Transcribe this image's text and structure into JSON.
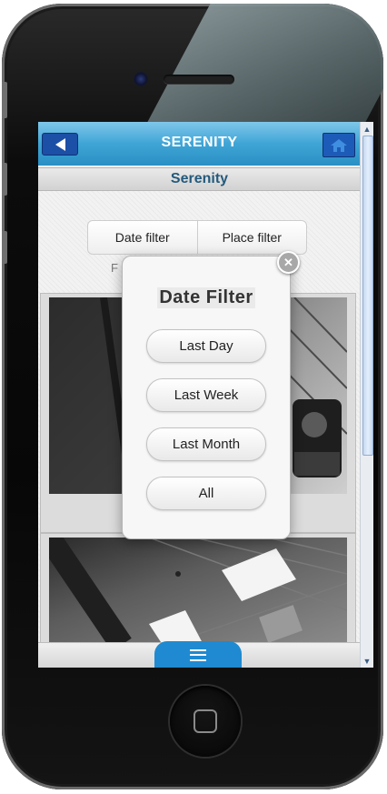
{
  "app": {
    "title": "SERENITY",
    "subtitle": "Serenity"
  },
  "filters": {
    "date_label": "Date filter",
    "place_label": "Place filter",
    "partial_label": "F"
  },
  "popup": {
    "title": "Date Filter",
    "options": [
      "Last Day",
      "Last Week",
      "Last Month",
      "All"
    ]
  },
  "icons": {
    "back": "back-arrow-icon",
    "home": "home-icon",
    "close": "close-icon",
    "menu": "hamburger-menu-icon"
  },
  "colors": {
    "header_blue": "#3fa5d6",
    "button_navy": "#1c4fa6",
    "subtitle_text": "#245a7c",
    "menu_tab": "#1f8ad1"
  }
}
